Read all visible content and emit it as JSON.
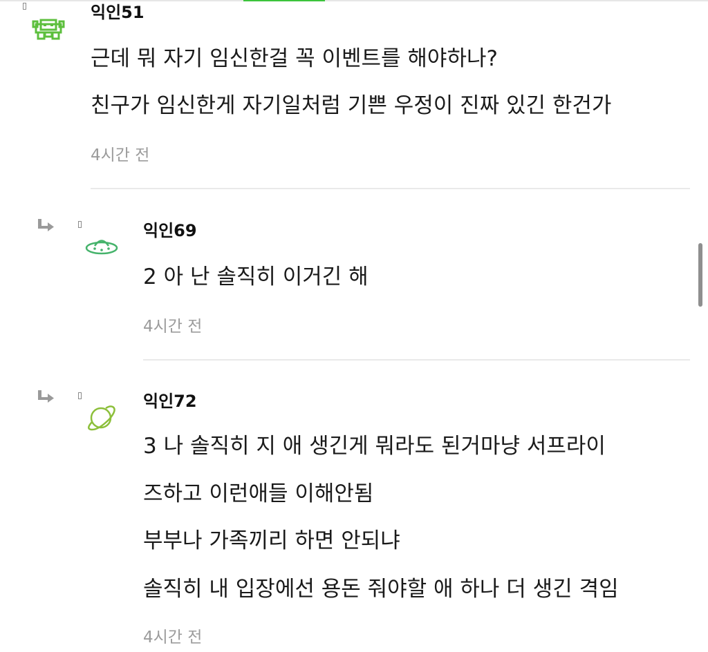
{
  "comments": [
    {
      "name": "익인51",
      "avatar_icon": "space-invader-icon",
      "avatar_color": "#5cbf3d",
      "lines": [
        "근데 뭐 자기 임신한걸 꼭 이벤트를 해야하나?",
        "친구가 임신한게 자기일처럼 기쁜 우정이 진짜 있긴 한건가"
      ],
      "time": "4시간 전"
    },
    {
      "name": "익인69",
      "avatar_icon": "ufo-icon",
      "avatar_color": "#45b36b",
      "reply_icon": "reply-arrow-icon",
      "lines": [
        "2 아 난 솔직히 이거긴 해"
      ],
      "time": "4시간 전"
    },
    {
      "name": "익인72",
      "avatar_icon": "planet-icon",
      "avatar_color": "#8cbf3a",
      "reply_icon": "reply-arrow-icon",
      "lines": [
        "3 나 솔직히 지 애 생긴게 뭐라도 된거마냥 서프라이",
        "즈하고 이런애들 이해안됨",
        "부부나 가족끼리 하면 안되냐",
        "솔직히 내 입장에선 용돈 줘야할 애 하나 더 생긴 격임"
      ],
      "time": "4시간 전"
    }
  ]
}
